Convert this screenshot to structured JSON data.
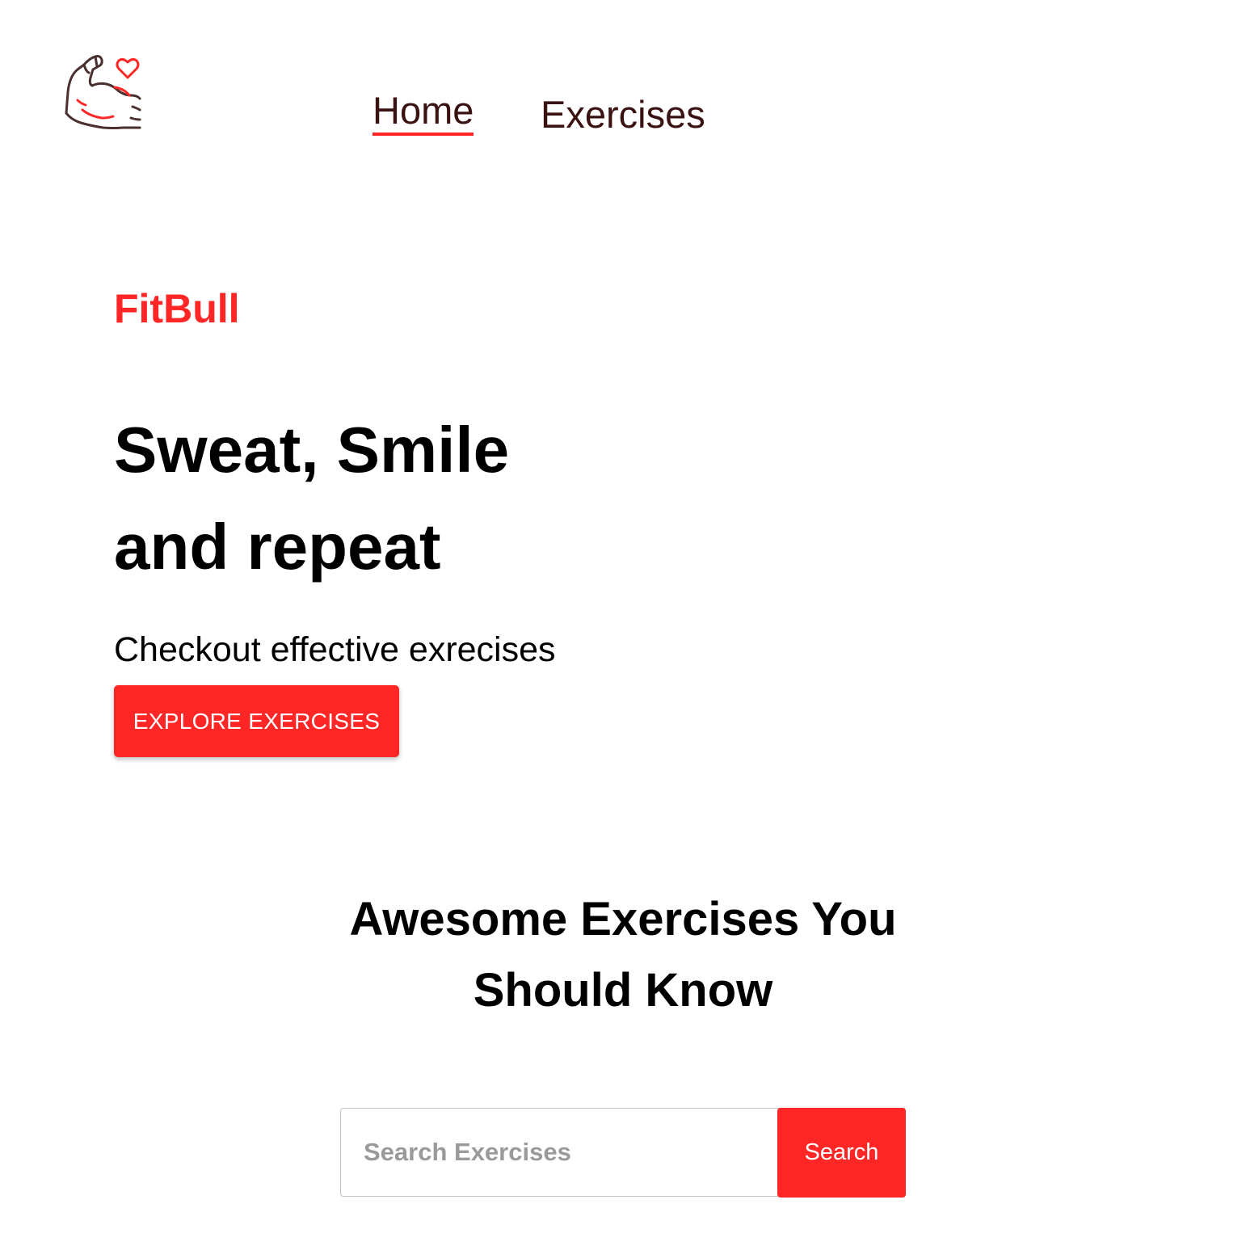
{
  "header": {
    "logo_icon": "flexed-arm-heart-icon",
    "nav": {
      "home_label": "Home",
      "exercises_label": "Exercises",
      "active": "Home"
    }
  },
  "hero": {
    "brand": "FitBull",
    "headline_line1": "Sweat, Smile",
    "headline_line2": "and repeat",
    "subtext": "Checkout effective exrecises",
    "cta_label": "EXPLORE EXERCISES"
  },
  "search_section": {
    "title_line1": "Awesome Exercises You",
    "title_line2": "Should Know",
    "input_placeholder": "Search Exercises",
    "input_value": "",
    "button_label": "Search"
  },
  "colors": {
    "accent": "#ff2625",
    "nav_text": "#3a1212",
    "text": "#000000",
    "background": "#ffffff"
  }
}
